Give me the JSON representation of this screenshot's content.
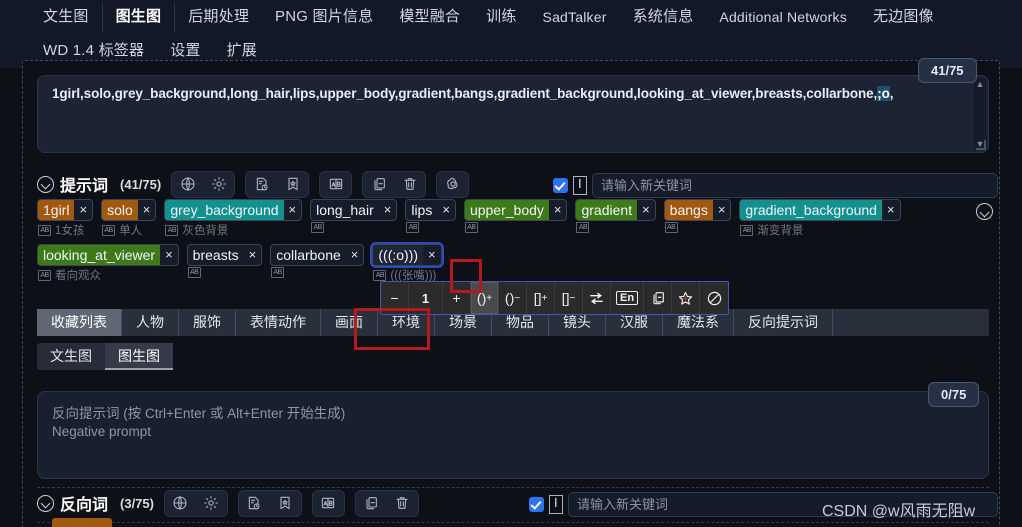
{
  "navbar": {
    "row1": [
      {
        "label": "文生图",
        "active": false,
        "latin": false
      },
      {
        "label": "图生图",
        "active": true,
        "latin": false
      },
      {
        "label": "后期处理",
        "active": false,
        "latin": false
      },
      {
        "label": "PNG 图片信息",
        "active": false,
        "latin": false
      },
      {
        "label": "模型融合",
        "active": false,
        "latin": false
      },
      {
        "label": "训练",
        "active": false,
        "latin": false
      },
      {
        "label": "SadTalker",
        "active": false,
        "latin": true
      },
      {
        "label": "系统信息",
        "active": false,
        "latin": false
      },
      {
        "label": "Additional Networks",
        "active": false,
        "latin": true
      },
      {
        "label": "无边图像",
        "active": false,
        "latin": false
      }
    ],
    "row2": [
      {
        "label": "WD 1.4 标签器",
        "active": false,
        "latin": false
      },
      {
        "label": "设置",
        "active": false,
        "latin": false
      },
      {
        "label": "扩展",
        "active": false,
        "latin": false
      }
    ]
  },
  "prompt": {
    "text_before": "1girl,solo,grey_background,long_hair,lips,upper_body,gradient,bangs,gradient_background,looking_at_viewer,breasts,collarbone,",
    "text_selected": ";o",
    "text_after": ",",
    "counter": "41/75",
    "scroll_up": "▲",
    "scroll_down": "▼"
  },
  "positive_section": {
    "title": "提示词",
    "count": "(41/75)",
    "icon_groups": [
      [
        "globe-icon",
        "gear-icon"
      ],
      [
        "history-icon",
        "bookmark-star-icon"
      ],
      [
        "translate-ab-icon"
      ],
      [
        "copy-icon",
        "trash-icon"
      ],
      [
        "openai-icon"
      ]
    ],
    "keyword_checkbox_checked": true,
    "keyword_placeholder": "请输入新关键词"
  },
  "chips": {
    "row1": [
      {
        "label": "1girl",
        "color": "orange",
        "sub": "1女孩",
        "highlight": false
      },
      {
        "label": "solo",
        "color": "orange",
        "sub": "单人",
        "highlight": false
      },
      {
        "label": "grey_background",
        "color": "teal",
        "sub": "灰色背景",
        "highlight": false
      },
      {
        "label": "long_hair",
        "color": "plain",
        "sub": "",
        "highlight": false
      },
      {
        "label": "lips",
        "color": "plain",
        "sub": "",
        "highlight": false
      },
      {
        "label": "upper_body",
        "color": "green",
        "sub": "",
        "highlight": false
      },
      {
        "label": "gradient",
        "color": "green",
        "sub": "",
        "highlight": false
      },
      {
        "label": "bangs",
        "color": "orange",
        "sub": "",
        "highlight": false
      },
      {
        "label": "gradient_background",
        "color": "teal",
        "sub": "渐变背景",
        "highlight": false
      }
    ],
    "row2": [
      {
        "label": "looking_at_viewer",
        "color": "green",
        "sub": "看向观众",
        "highlight": false
      },
      {
        "label": "breasts",
        "color": "plain",
        "sub": "",
        "highlight": false
      },
      {
        "label": "collarbone",
        "color": "plain",
        "sub": "",
        "highlight": false
      },
      {
        "label": "(((:o)))",
        "color": "dark",
        "sub": "(((张嘴)))",
        "highlight": true
      }
    ],
    "close_glyph": "×"
  },
  "format_toolbar": {
    "buttons": [
      {
        "name": "decrease-weight-button",
        "glyph": "−",
        "kind": "plain",
        "selected": false
      },
      {
        "name": "weight-value",
        "glyph": "1",
        "kind": "num",
        "selected": false
      },
      {
        "name": "increase-weight-button",
        "glyph": "+",
        "kind": "plain",
        "selected": false
      },
      {
        "name": "add-paren-button",
        "base": "()",
        "sup": "+",
        "kind": "sup",
        "selected": true
      },
      {
        "name": "remove-paren-button",
        "base": "()",
        "sup": "−",
        "kind": "sup",
        "selected": false
      },
      {
        "name": "add-bracket-button",
        "base": "[]",
        "sup": "+",
        "kind": "sup",
        "selected": false
      },
      {
        "name": "remove-bracket-button",
        "base": "[]",
        "sup": "−",
        "kind": "sup",
        "selected": false
      },
      {
        "name": "swap-arrows-icon",
        "glyph": "",
        "kind": "icon-swap",
        "selected": false
      },
      {
        "name": "english-toggle-button",
        "glyph": "En",
        "kind": "boxed",
        "selected": false
      },
      {
        "name": "copy-tag-button",
        "glyph": "",
        "kind": "icon-copy",
        "selected": false
      },
      {
        "name": "favorite-star-button",
        "glyph": "",
        "kind": "icon-star",
        "selected": false
      },
      {
        "name": "ban-button",
        "glyph": "",
        "kind": "icon-ban",
        "selected": false
      }
    ]
  },
  "category_tabs": [
    {
      "label": "收藏列表",
      "active": true
    },
    {
      "label": "人物",
      "active": false
    },
    {
      "label": "服饰",
      "active": false
    },
    {
      "label": "表情动作",
      "active": false
    },
    {
      "label": "画面",
      "active": false
    },
    {
      "label": "环境",
      "active": false
    },
    {
      "label": "场景",
      "active": false
    },
    {
      "label": "物品",
      "active": false
    },
    {
      "label": "镜头",
      "active": false
    },
    {
      "label": "汉服",
      "active": false
    },
    {
      "label": "魔法系",
      "active": false
    },
    {
      "label": "反向提示词",
      "active": false
    }
  ],
  "sub_tabs": [
    {
      "label": "文生图",
      "active": false
    },
    {
      "label": "图生图",
      "active": true
    }
  ],
  "negative_prompt": {
    "placeholder_line1": "反向提示词 (按 Ctrl+Enter 或 Alt+Enter 开始生成)",
    "placeholder_line2": "Negative prompt",
    "counter": "0/75"
  },
  "negative_section": {
    "title": "反向词",
    "count": "(3/75)",
    "icon_groups": [
      [
        "globe-icon",
        "gear-icon"
      ],
      [
        "history-icon",
        "bookmark-star-icon"
      ],
      [
        "translate-ab-icon"
      ],
      [
        "copy-icon",
        "trash-icon"
      ]
    ],
    "keyword_checkbox_checked": true,
    "keyword_placeholder": "请输入新关键词"
  },
  "watermark": "CSDN @w风雨无阻w",
  "colors": {
    "chip_orange": "#a2590f",
    "chip_teal": "#13918f",
    "chip_green": "#3f7a18",
    "accent_blue": "#2d72f0",
    "highlight_red": "#b51919",
    "selection_blue": "#1f4f6d"
  }
}
